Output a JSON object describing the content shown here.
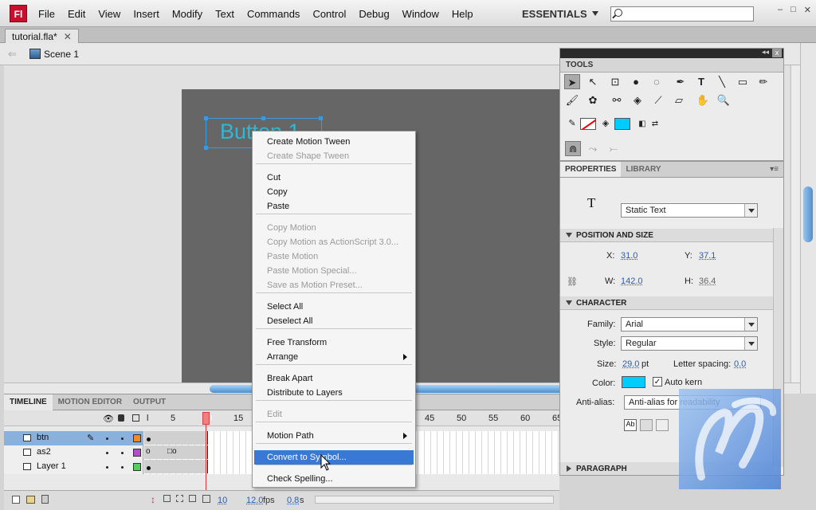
{
  "app": {
    "logo_text": "Fl",
    "brand_color": "#c8102e"
  },
  "menu": {
    "items": [
      "File",
      "Edit",
      "View",
      "Insert",
      "Modify",
      "Text",
      "Commands",
      "Control",
      "Debug",
      "Window",
      "Help"
    ]
  },
  "workspace": {
    "label": "ESSENTIALS"
  },
  "search": {
    "placeholder": ""
  },
  "window_controls": {
    "minimize": "–",
    "maximize": "□",
    "close": "✕"
  },
  "document": {
    "tab_label": "tutorial.fla*",
    "close_glyph": "✕"
  },
  "scenebar": {
    "back_glyph": "⇐",
    "scene_label": "Scene 1"
  },
  "stage": {
    "button_text": "Button 1",
    "button_text_color": "#26c6e8",
    "stage_color": "#666666"
  },
  "context_menu": {
    "items": [
      {
        "label": "Create Motion Tween",
        "enabled": true
      },
      {
        "label": "Create Shape Tween",
        "enabled": false
      },
      {
        "label": "Cut",
        "enabled": true
      },
      {
        "label": "Copy",
        "enabled": true
      },
      {
        "label": "Paste",
        "enabled": true
      },
      {
        "label": "Copy Motion",
        "enabled": false
      },
      {
        "label": "Copy Motion as ActionScript 3.0...",
        "enabled": false
      },
      {
        "label": "Paste Motion",
        "enabled": false
      },
      {
        "label": "Paste Motion Special...",
        "enabled": false
      },
      {
        "label": "Save as Motion Preset...",
        "enabled": false
      },
      {
        "label": "Select All",
        "enabled": true
      },
      {
        "label": "Deselect All",
        "enabled": true
      },
      {
        "label": "Free Transform",
        "enabled": true
      },
      {
        "label": "Arrange",
        "enabled": true,
        "submenu": true
      },
      {
        "label": "Break Apart",
        "enabled": true
      },
      {
        "label": "Distribute to Layers",
        "enabled": true
      },
      {
        "label": "Edit",
        "enabled": false
      },
      {
        "label": "Motion Path",
        "enabled": true,
        "submenu": true
      },
      {
        "label": "Convert to Symbol...",
        "enabled": true,
        "highlighted": true
      },
      {
        "label": "Check Spelling...",
        "enabled": true
      }
    ]
  },
  "timeline": {
    "tabs": [
      "TIMELINE",
      "MOTION EDITOR",
      "OUTPUT"
    ],
    "frame_numbers": [
      "l",
      "5",
      "10",
      "15",
      "45",
      "50",
      "55",
      "60",
      "65"
    ],
    "layers": [
      {
        "name": "btn",
        "color": "#f08a24",
        "selected": true
      },
      {
        "name": "as2",
        "color": "#b14fc5",
        "selected": false
      },
      {
        "name": "Layer 1",
        "color": "#4fd05f",
        "selected": false
      }
    ],
    "status": {
      "current_frame": "10",
      "fps": "12.0",
      "fps_unit": "fps",
      "elapsed": "0.8",
      "elapsed_unit": "s"
    }
  },
  "tools_panel": {
    "title": "TOOLS",
    "collapse_glyph": "◂◂",
    "close_glyph": "x",
    "fill_color": "#00ccff"
  },
  "properties_panel": {
    "tabs": [
      "PROPERTIES",
      "LIBRARY"
    ],
    "text_icon": "T",
    "text_type": "Static Text",
    "position_and_size": {
      "title": "POSITION AND SIZE",
      "x_label": "X:",
      "x_value": "31.0",
      "y_label": "Y:",
      "y_value": "37.1",
      "w_label": "W:",
      "w_value": "142.0",
      "h_label": "H:",
      "h_value": "36.4"
    },
    "character": {
      "title": "CHARACTER",
      "family_label": "Family:",
      "family_value": "Arial",
      "style_label": "Style:",
      "style_value": "Regular",
      "size_label": "Size:",
      "size_value": "29.0",
      "size_unit": "pt",
      "letter_spacing_label": "Letter spacing:",
      "letter_spacing_value": "0.0",
      "color_label": "Color:",
      "color_value": "#00ccff",
      "auto_kern_label": "Auto kern",
      "auto_kern_checked": true,
      "anti_alias_label": "Anti-alias:",
      "anti_alias_value": "Anti-alias for readability"
    },
    "paragraph": {
      "title": "PARAGRAPH"
    }
  }
}
